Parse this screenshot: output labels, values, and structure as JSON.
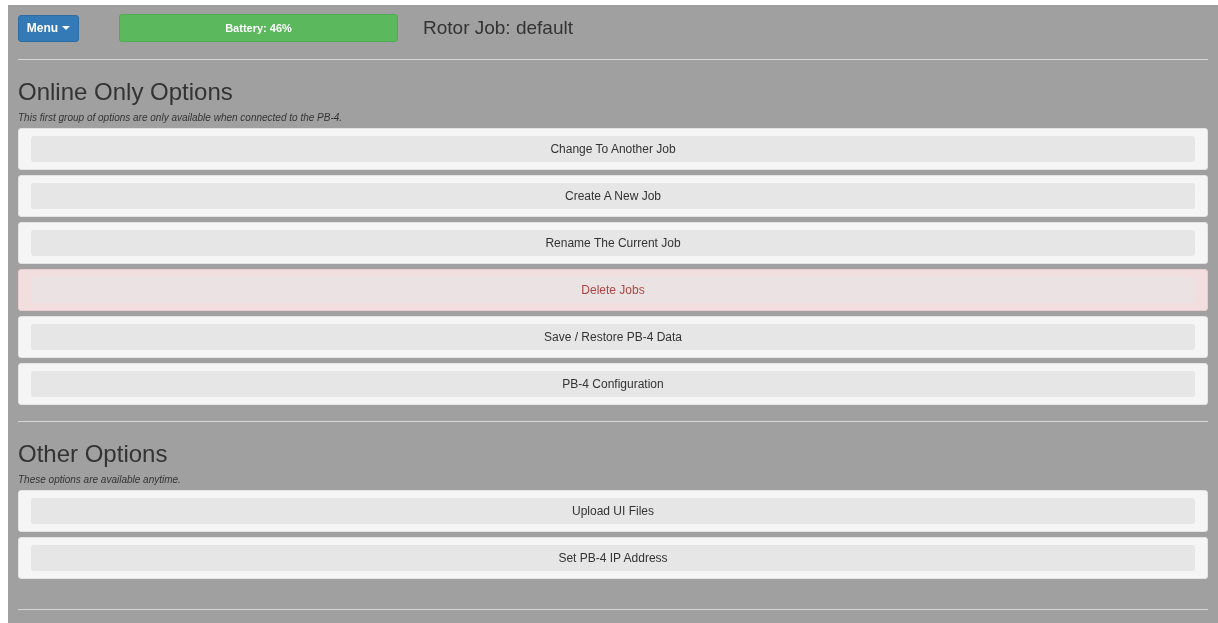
{
  "header": {
    "menu_button": "Menu",
    "battery": "Battery: 46%",
    "job_title": "Rotor Job: default"
  },
  "sections": [
    {
      "title": "Online Only Options",
      "subtitle": "This first group of options are only available when connected to the PB-4.",
      "options": [
        {
          "label": "Change To Another Job",
          "kind": "default"
        },
        {
          "label": "Create A New Job",
          "kind": "default"
        },
        {
          "label": "Rename The Current Job",
          "kind": "default"
        },
        {
          "label": "Delete Jobs",
          "kind": "danger"
        },
        {
          "label": "Save / Restore PB-4 Data",
          "kind": "default"
        },
        {
          "label": "PB-4 Configuration",
          "kind": "default"
        }
      ]
    },
    {
      "title": "Other Options",
      "subtitle": "These options are available anytime.",
      "options": [
        {
          "label": "Upload UI Files",
          "kind": "default"
        },
        {
          "label": "Set PB-4 IP Address",
          "kind": "default"
        }
      ]
    }
  ]
}
